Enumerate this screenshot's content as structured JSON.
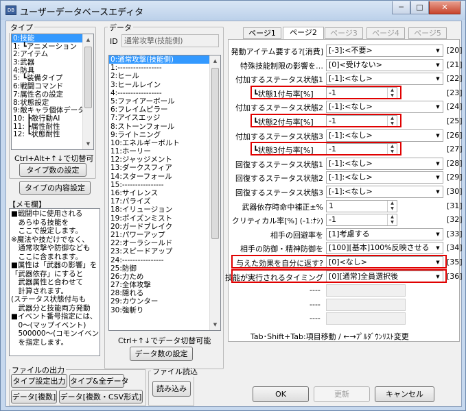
{
  "window": {
    "title": "ユーザーデータベースエディタ",
    "icon_text": "DB"
  },
  "type_group": {
    "label": "タイプ",
    "items": [
      "0:技能",
      "1: ┗アニメーション",
      "2:アイテム",
      "3:武器",
      "4:防具",
      "5: ┗装備タイプ",
      "6:戦闘コマンド",
      "7:属性名の設定",
      "8:状態設定",
      "9:敵キャラ個体データ",
      "10: ┣敵行動AI",
      "11: ┣属性耐性",
      "12: ┗状態耐性"
    ],
    "selected": 0,
    "hint": "Ctrl+Alt+↑↓で切替可",
    "count_button": "タイプ数の設定",
    "content_button": "タイプの内容設定"
  },
  "memo": {
    "label": "【メモ欄】",
    "lines": [
      "■戦闘中に使用される",
      "　あらゆる技能を",
      "　ここで設定します。",
      "※魔法や技だけでなく、",
      "　通常攻撃や防御なども",
      "　ここに含まれます。",
      "■属性は「武器の影響」を",
      "「武器依存」にすると",
      "　武器属性と合わせて",
      "　計算されます。",
      "(ステータス状態付与も",
      "　武器分と技能両方発動",
      "■イベント番号指定には、",
      "　0〜(マップイベント)",
      "　500000〜(コモンイベント",
      "　を指定します。"
    ]
  },
  "file_output": {
    "label": "ファイルの出力",
    "buttons": [
      "タイプ設定出力",
      "タイプ&全データ",
      "データ[複数]",
      "データ[複数・CSV形式]"
    ]
  },
  "file_read": {
    "label": "ファイル読込",
    "button": "読み込み"
  },
  "data_group": {
    "label": "データ",
    "id_label": "ID",
    "id_value": "通常攻撃(技能側)",
    "items": [
      "0:通常攻撃(技能側)",
      "1:-----------------",
      "2:ヒール",
      "3:ヒールレイン",
      "4:-----------------",
      "5:ファイアーボール",
      "6:フレイムピラー",
      "7:アイスエッジ",
      "8:ストーンフォール",
      "9:ライトニング",
      "10:エネルギーボルト",
      "11:ホーリー",
      "12:ジャッジメント",
      "13:ダークスフィア",
      "14:スターフォール",
      "15:----------------",
      "16:サイレンス",
      "17:パライズ",
      "18:イリュージョン",
      "19:ポイズンミスト",
      "20:ガードブレイク",
      "21:パワーアップ",
      "22:オーラシールド",
      "23:スピードアップ",
      "24:----------------",
      "25:防御",
      "26:力ため",
      "27:全体攻撃",
      "28:隠れる",
      "29:カウンター",
      "30:強斬り"
    ],
    "selected": 0,
    "hint": "Ctrl+↑↓でデータ切替可能",
    "count_button": "データ数の設定"
  },
  "tabs": [
    {
      "label": "ページ1",
      "state": "normal"
    },
    {
      "label": "ページ2",
      "state": "active"
    },
    {
      "label": "ページ3",
      "state": "disabled"
    },
    {
      "label": "ページ4",
      "state": "disabled"
    },
    {
      "label": "ページ5",
      "state": "disabled"
    }
  ],
  "fields": [
    {
      "label": "発動アイテム要する?[消費]",
      "kind": "combo",
      "value": "[-3]:<不要>",
      "num": "[20]"
    },
    {
      "label": "特殊技能制限の影響を…",
      "kind": "combo",
      "value": "[0]<受けない>",
      "num": "[21]"
    },
    {
      "label": "付加するステータス状態1",
      "kind": "combo",
      "value": "[-1]:<なし>",
      "num": "[22]"
    },
    {
      "label": "┗状態1付与率[%]",
      "kind": "spin",
      "value": "-1",
      "num": "[23]",
      "highlight": true
    },
    {
      "label": "付加するステータス状態2",
      "kind": "combo",
      "value": "[-1]:<なし>",
      "num": "[24]"
    },
    {
      "label": "┗状態2付与率[%]",
      "kind": "spin",
      "value": "-1",
      "num": "[25]",
      "highlight": true
    },
    {
      "label": "付加するステータス状態3",
      "kind": "combo",
      "value": "[-1]:<なし>",
      "num": "[26]"
    },
    {
      "label": "┗状態3付与率[%]",
      "kind": "spin",
      "value": "-1",
      "num": "[27]",
      "highlight": true
    },
    {
      "label": "回復するステータス状態1",
      "kind": "combo",
      "value": "[-1]:<なし>",
      "num": "[28]"
    },
    {
      "label": "回復するステータス状態2",
      "kind": "combo",
      "value": "[-1]:<なし>",
      "num": "[29]"
    },
    {
      "label": "回復するステータス状態3",
      "kind": "combo",
      "value": "[-1]:<なし>",
      "num": "[30]"
    },
    {
      "label": "武器依存時命中補正±%",
      "kind": "spin",
      "value": "1",
      "num": "[31]"
    },
    {
      "label": "クリティカル率[%] (-1:ﾅｼ)",
      "kind": "spin",
      "value": "-1",
      "num": "[32]"
    },
    {
      "label": "相手の回避率を",
      "kind": "combo",
      "value": "[1]考慮する",
      "num": "[33]"
    },
    {
      "label": "相手の防御・精神防御を",
      "kind": "combo",
      "value": "[100][基本]100%反映させる",
      "num": "[34]"
    },
    {
      "label": "与えた効果を自分に返す?",
      "kind": "combo",
      "value": "[0]<なし>",
      "num": "[35]",
      "highlight": true
    },
    {
      "label": "技能が実行されるタイミング",
      "kind": "combo",
      "value": "[0][通常]全員選択後",
      "num": "[36]",
      "highlight": true
    }
  ],
  "placeholders": [
    "----",
    "----",
    "----"
  ],
  "nav_hint": "Tab･Shift+Tab:項目移動 / ←→ﾌﾟﾙﾀﾞｳﾝﾘｽﾄ変更",
  "footer": {
    "ok": "OK",
    "update": "更新",
    "cancel": "キャンセル"
  }
}
